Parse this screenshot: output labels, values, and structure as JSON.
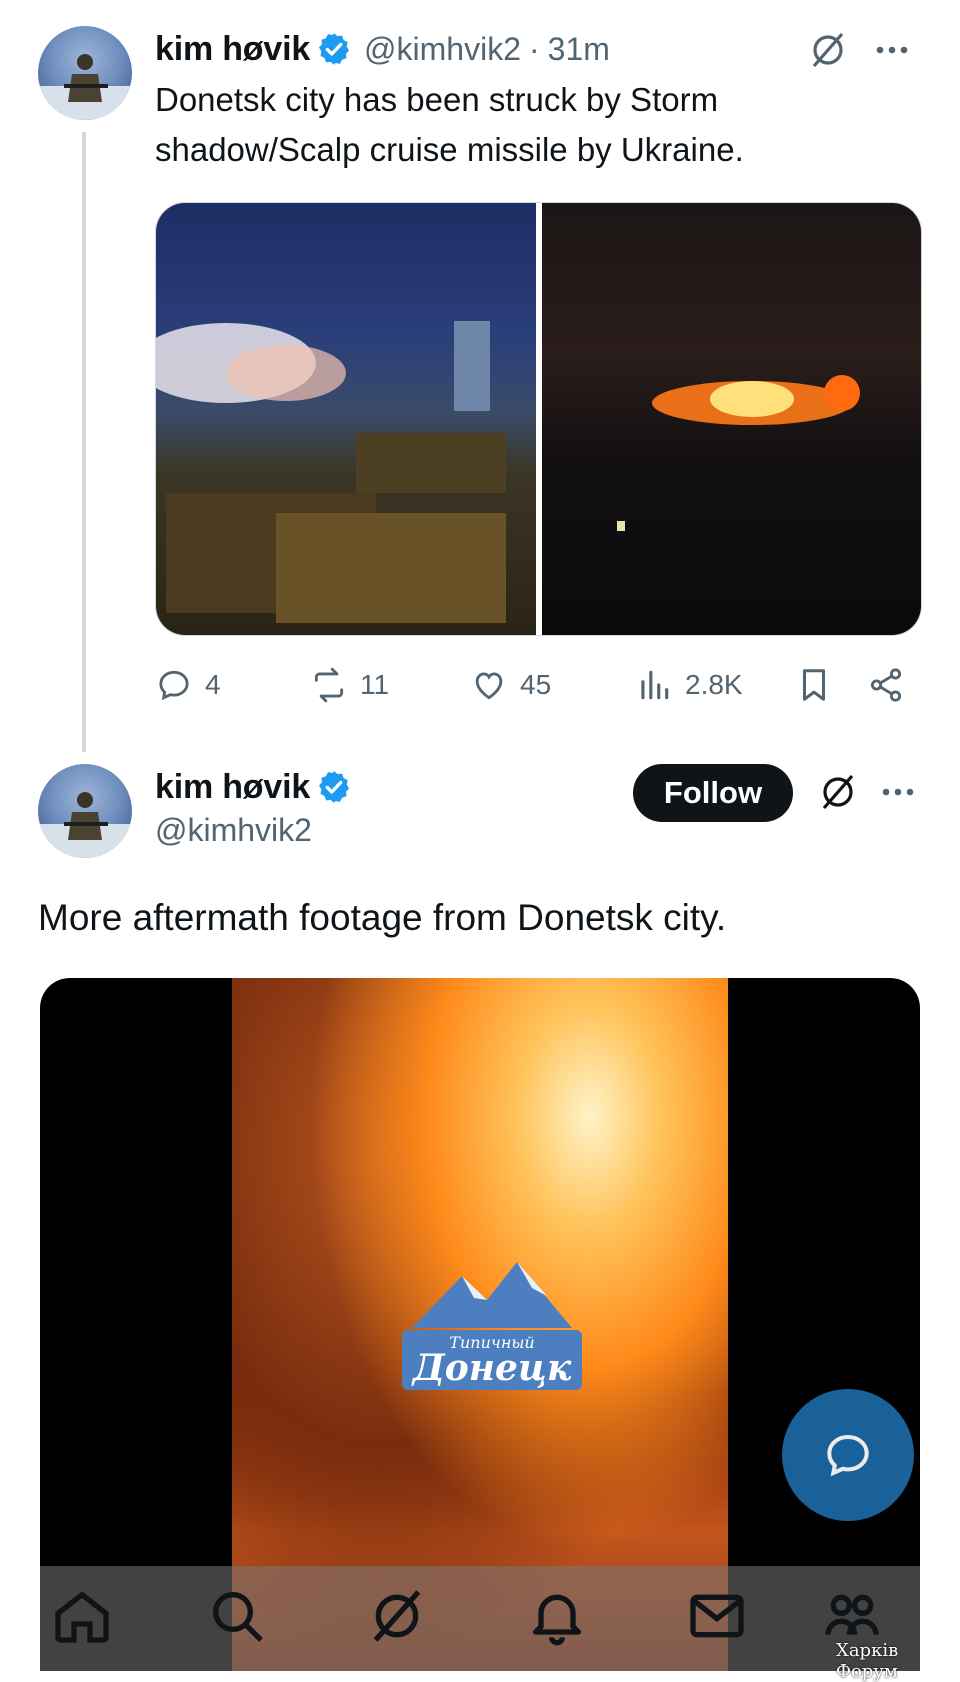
{
  "tweet1": {
    "name": "kim høvik",
    "handle": "@kimhvik2",
    "separator": "·",
    "time": "31m",
    "text": "Donetsk city has been struck by Storm shadow/Scalp cruise missile by Ukraine.",
    "actions": {
      "replies": "4",
      "reposts": "11",
      "likes": "45",
      "views": "2.8K"
    }
  },
  "tweet2": {
    "name": "kim høvik",
    "handle": "@kimhvik2",
    "follow_label": "Follow",
    "text": "More aftermath footage from Donetsk city.",
    "video_overlay_logo": "Типичный Донецк"
  },
  "watermark": "Харків Форум",
  "icons": {
    "verified": "verified-badge-icon",
    "grok": "grok-icon",
    "more": "more-icon",
    "reply": "reply-icon",
    "repost": "repost-icon",
    "like": "like-icon",
    "views": "views-icon",
    "bookmark": "bookmark-icon",
    "share": "share-icon",
    "compose": "compose-icon",
    "nav": [
      "home-icon",
      "search-icon",
      "grok-icon",
      "notifications-icon",
      "messages-icon",
      "communities-icon"
    ]
  },
  "colors": {
    "accent": "#1d9bf0",
    "text": "#0f1419",
    "muted": "#536471",
    "follow_bg": "#0f1419",
    "fab": "#1d6aa8"
  }
}
